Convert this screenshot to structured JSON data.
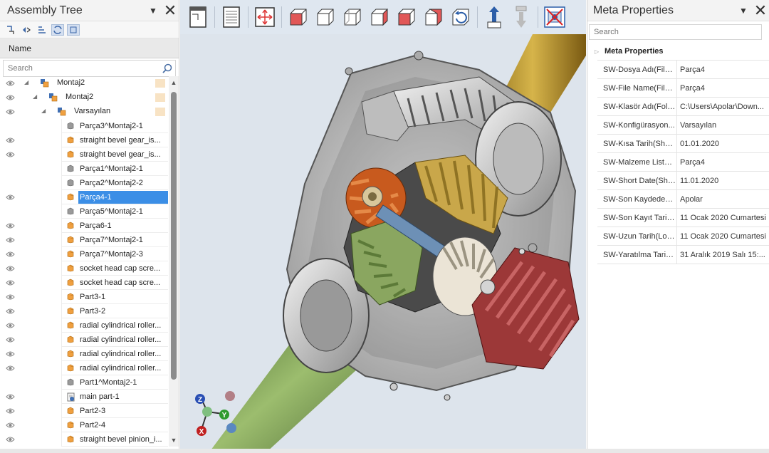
{
  "assembly_tree": {
    "title": "Assembly Tree",
    "column_header": "Name",
    "search_placeholder": "Search",
    "rows": [
      {
        "label": "Montaj2",
        "indent": 1,
        "icon": "assembly-icon",
        "eye": true,
        "expander": true
      },
      {
        "label": "Montaj2",
        "indent": 2,
        "icon": "assembly-icon",
        "eye": true,
        "expander": true
      },
      {
        "label": "Varsayılan",
        "indent": 3,
        "icon": "configuration-icon",
        "eye": true,
        "expander": true
      },
      {
        "label": "Parça3^Montaj2-1",
        "indent": 4,
        "icon": "part-gray-icon",
        "eye": false
      },
      {
        "label": "straight bevel gear_is...",
        "indent": 4,
        "icon": "part-orange-icon",
        "eye": true
      },
      {
        "label": "straight bevel gear_is...",
        "indent": 4,
        "icon": "part-orange-icon",
        "eye": true
      },
      {
        "label": "Parça1^Montaj2-1",
        "indent": 4,
        "icon": "part-gray-icon",
        "eye": false
      },
      {
        "label": "Parça2^Montaj2-2",
        "indent": 4,
        "icon": "part-gray-icon",
        "eye": false
      },
      {
        "label": "Parça4-1",
        "indent": 4,
        "icon": "part-orange-icon",
        "eye": true,
        "selected": true
      },
      {
        "label": "Parça5^Montaj2-1",
        "indent": 4,
        "icon": "part-gray-icon",
        "eye": false
      },
      {
        "label": "Parça6-1",
        "indent": 4,
        "icon": "part-orange-icon",
        "eye": true
      },
      {
        "label": "Parça7^Montaj2-1",
        "indent": 4,
        "icon": "part-orange-icon",
        "eye": true
      },
      {
        "label": "Parça7^Montaj2-3",
        "indent": 4,
        "icon": "part-orange-icon",
        "eye": true
      },
      {
        "label": "socket head cap scre...",
        "indent": 4,
        "icon": "part-orange-icon",
        "eye": true
      },
      {
        "label": "socket head cap scre...",
        "indent": 4,
        "icon": "part-orange-icon",
        "eye": true
      },
      {
        "label": "Part3-1",
        "indent": 4,
        "icon": "part-orange-icon",
        "eye": true
      },
      {
        "label": "Part3-2",
        "indent": 4,
        "icon": "part-orange-icon",
        "eye": true
      },
      {
        "label": "radial cylindrical roller...",
        "indent": 4,
        "icon": "part-orange-icon",
        "eye": true
      },
      {
        "label": "radial cylindrical roller...",
        "indent": 4,
        "icon": "part-orange-icon",
        "eye": true
      },
      {
        "label": "radial cylindrical roller...",
        "indent": 4,
        "icon": "part-orange-icon",
        "eye": true
      },
      {
        "label": "radial cylindrical roller...",
        "indent": 4,
        "icon": "part-orange-icon",
        "eye": true
      },
      {
        "label": "Part1^Montaj2-1",
        "indent": 4,
        "icon": "part-gray-icon",
        "eye": false
      },
      {
        "label": "main part-1",
        "indent": 4,
        "icon": "main-part-icon",
        "eye": true
      },
      {
        "label": "Part2-3",
        "indent": 4,
        "icon": "part-orange-icon",
        "eye": true
      },
      {
        "label": "Part2-4",
        "indent": 4,
        "icon": "part-orange-icon",
        "eye": true
      },
      {
        "label": "straight bevel pinion_i...",
        "indent": 4,
        "icon": "part-orange-icon",
        "eye": true
      }
    ]
  },
  "toolbar": {
    "buttons": [
      "page-view-icon",
      "document-icon",
      "fit-all-icon",
      "view-front-icon",
      "view-back-icon",
      "view-left-icon",
      "view-right-icon",
      "view-top-icon",
      "view-bottom-icon",
      "rotate-view-icon",
      "explode-up-icon",
      "explode-down-icon",
      "hide-selection-icon"
    ]
  },
  "axis_triad": {
    "labels": [
      "Z",
      "Y",
      "X"
    ]
  },
  "meta": {
    "title": "Meta Properties",
    "search_placeholder": "Search",
    "section": "Meta Properties",
    "rows": [
      {
        "key": "SW-Dosya Adı(File ...",
        "value": "Parça4"
      },
      {
        "key": "SW-File Name(File ...",
        "value": "Parça4"
      },
      {
        "key": "SW-Klasör Adı(Fold...",
        "value": "C:\\Users\\Apolar\\Down..."
      },
      {
        "key": "SW-Konfigürasyon...",
        "value": "Varsayılan"
      },
      {
        "key": "SW-Kısa Tarih(Short...",
        "value": "01.01.2020"
      },
      {
        "key": "SW-Malzeme Listes...",
        "value": "Parça4"
      },
      {
        "key": "SW-Short Date(Sho...",
        "value": "11.01.2020"
      },
      {
        "key": "SW-Son Kaydeden(...",
        "value": "Apolar"
      },
      {
        "key": "SW-Son Kayıt Tarihi...",
        "value": "11 Ocak 2020 Cumartesi"
      },
      {
        "key": "SW-Uzun Tarih(Lon...",
        "value": "11 Ocak 2020 Cumartesi"
      },
      {
        "key": "SW-Yaratılma Tarihi...",
        "value": "31 Aralık 2019 Salı 15:..."
      }
    ]
  }
}
